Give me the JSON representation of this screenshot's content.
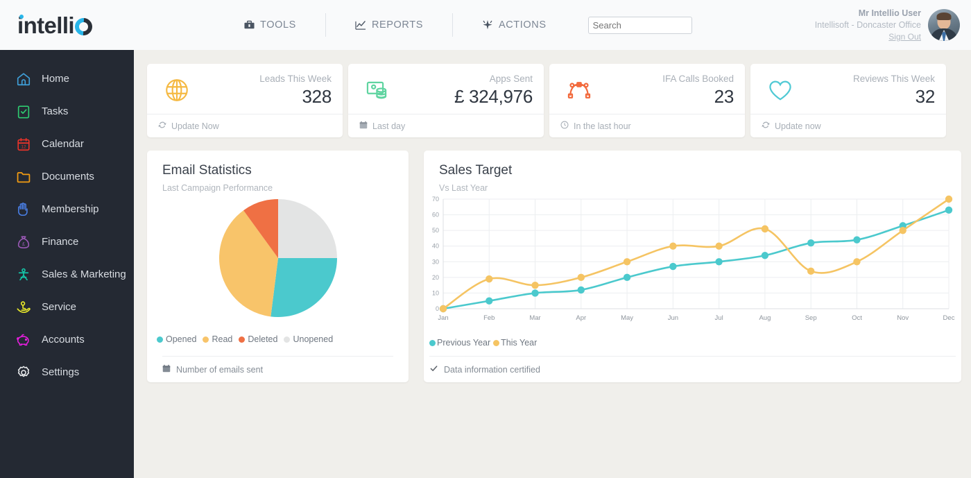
{
  "brand": {
    "name": "intelli",
    "ring": "O",
    "dot_color": "#29b6ea",
    "text_color": "#2b3038"
  },
  "topnav": {
    "items": [
      {
        "label": "TOOLS",
        "icon": "toolbox-icon"
      },
      {
        "label": "REPORTS",
        "icon": "line-chart-icon"
      },
      {
        "label": "ACTIONS",
        "icon": "sparkle-icon"
      }
    ],
    "search": {
      "placeholder": "Search",
      "value": ""
    },
    "user": {
      "name": "Mr Intellio User",
      "org": "Intellisoft - Doncaster Office",
      "signout": "Sign Out"
    }
  },
  "sidebar": {
    "items": [
      {
        "label": "Home",
        "icon": "home-icon",
        "color": "#3f9fd8"
      },
      {
        "label": "Tasks",
        "icon": "clipboard-check-icon",
        "color": "#2ecc71"
      },
      {
        "label": "Calendar",
        "icon": "calendar-icon",
        "color": "#e8332a"
      },
      {
        "label": "Documents",
        "icon": "folder-icon",
        "color": "#f39c12"
      },
      {
        "label": "Membership",
        "icon": "hand-icon",
        "color": "#4a80e8"
      },
      {
        "label": "Finance",
        "icon": "money-bag-icon",
        "color": "#9b59b6"
      },
      {
        "label": "Sales & Marketing",
        "icon": "sales-icon",
        "color": "#15c5a8"
      },
      {
        "label": "Service",
        "icon": "service-hand-icon",
        "color": "#e8e82a"
      },
      {
        "label": "Accounts",
        "icon": "piggy-bank-icon",
        "color": "#e91ee0"
      },
      {
        "label": "Settings",
        "icon": "gear-icon",
        "color": "#e8eaec"
      }
    ]
  },
  "stats": [
    {
      "label": "Leads This Week",
      "value": "328",
      "icon": "globe-icon",
      "color": "#f5b942",
      "foot": "Update Now",
      "foot_icon": "refresh-icon"
    },
    {
      "label": "Apps Sent",
      "value": "£ 324,976",
      "icon": "money-icon",
      "color": "#5fd4a0",
      "foot": "Last day",
      "foot_icon": "calendar-icon"
    },
    {
      "label": "IFA Calls Booked",
      "value": "23",
      "icon": "path-node-icon",
      "color": "#f26a3d",
      "foot": "In the last hour",
      "foot_icon": "clock-icon"
    },
    {
      "label": "Reviews This Week",
      "value": "32",
      "icon": "heart-icon",
      "color": "#4fc9d4",
      "foot": "Update now",
      "foot_icon": "refresh-icon"
    }
  ],
  "email_panel": {
    "title": "Email Statistics",
    "subtitle": "Last Campaign Performance",
    "footer": "Number of emails sent",
    "footer_icon": "calendar-icon"
  },
  "sales_panel": {
    "title": "Sales Target",
    "subtitle": "Vs Last Year",
    "footer": "Data information certified",
    "footer_icon": "check-icon"
  },
  "chart_data": [
    {
      "type": "pie",
      "title": "Email Statistics",
      "subtitle": "Last Campaign Performance",
      "legend_position": "bottom",
      "labels": [
        "Opened",
        "Read",
        "Deleted",
        "Unopened"
      ],
      "values": [
        27,
        38,
        10,
        25
      ],
      "colors": [
        "#4bc9cd",
        "#f8c46a",
        "#ef7044",
        "#e3e4e4"
      ],
      "slice_order_clockwise_from_top": [
        "Unopened",
        "Opened",
        "Read",
        "Deleted"
      ]
    },
    {
      "type": "line",
      "title": "Sales Target",
      "subtitle": "Vs Last Year",
      "xlabel": "",
      "ylabel": "",
      "grid": true,
      "legend_position": "bottom-left",
      "ylim": [
        0,
        70
      ],
      "yticks": [
        0,
        10,
        20,
        30,
        40,
        50,
        60,
        70
      ],
      "categories": [
        "Jan",
        "Feb",
        "Mar",
        "Apr",
        "May",
        "Jun",
        "Jul",
        "Aug",
        "Sep",
        "Oct",
        "Nov",
        "Dec"
      ],
      "series": [
        {
          "name": "Previous Year",
          "color": "#4bc9cd",
          "values": [
            0,
            5,
            10,
            12,
            20,
            27,
            30,
            34,
            42,
            44,
            53,
            63
          ]
        },
        {
          "name": "This Year",
          "color": "#f5c463",
          "values": [
            0,
            19,
            15,
            20,
            30,
            40,
            40,
            51,
            24,
            30,
            50,
            70
          ]
        }
      ]
    }
  ]
}
